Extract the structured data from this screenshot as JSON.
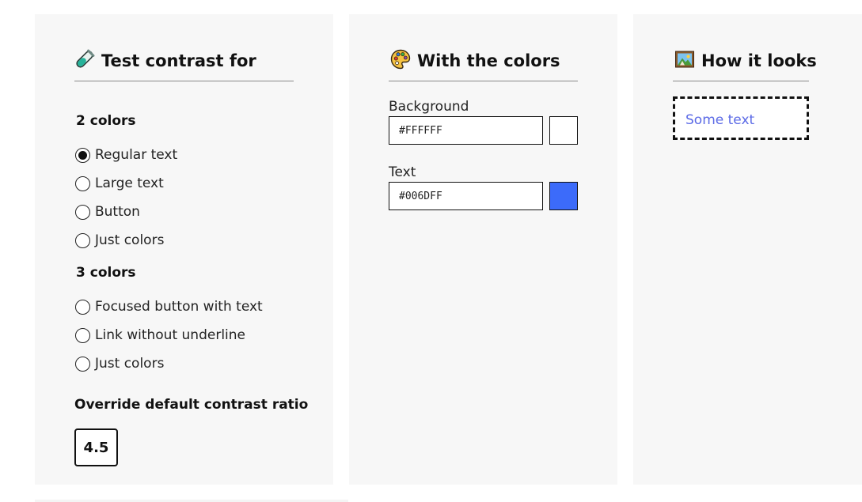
{
  "contrast_panel": {
    "title": "Test contrast for",
    "icon": "test-tube-icon",
    "group_two": {
      "label": "2 colors",
      "options": [
        {
          "label": "Regular text",
          "checked": true
        },
        {
          "label": "Large text",
          "checked": false
        },
        {
          "label": "Button",
          "checked": false
        },
        {
          "label": "Just colors",
          "checked": false
        }
      ]
    },
    "group_three": {
      "label": "3 colors",
      "options": [
        {
          "label": "Focused button with text",
          "checked": false
        },
        {
          "label": "Link without underline",
          "checked": false
        },
        {
          "label": "Just colors",
          "checked": false
        }
      ]
    },
    "override_label": "Override default contrast ratio",
    "override_value": "4.5"
  },
  "colors_panel": {
    "title": "With the colors",
    "icon": "palette-icon",
    "background": {
      "label": "Background",
      "value": "#FFFFFF",
      "swatch": "#FFFFFF"
    },
    "text": {
      "label": "Text",
      "value": "#006DFF",
      "swatch": "#3C6BFA"
    }
  },
  "preview_panel": {
    "title": "How it looks",
    "icon": "framed-picture-icon",
    "sample_text": "Some text",
    "sample_color": "#5B6AE6"
  }
}
